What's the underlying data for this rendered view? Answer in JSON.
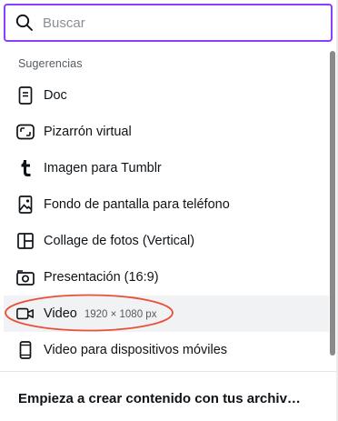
{
  "search": {
    "placeholder": "Buscar",
    "value": "",
    "icon": "search-icon",
    "border_color": "#8b3dff"
  },
  "suggestions": {
    "label": "Sugerencias",
    "items": [
      {
        "label": "Doc",
        "icon": "document-icon"
      },
      {
        "label": "Pizarrón virtual",
        "icon": "whiteboard-icon"
      },
      {
        "label": "Imagen para Tumblr",
        "icon": "tumblr-icon"
      },
      {
        "label": "Fondo de pantalla para teléfono",
        "icon": "image-icon"
      },
      {
        "label": "Collage de fotos (Vertical)",
        "icon": "collage-grid-icon"
      },
      {
        "label": "Presentación (16:9)",
        "icon": "presentation-icon"
      },
      {
        "label": "Video",
        "dimensions": "1920 × 1080 px",
        "icon": "video-camera-icon",
        "highlighted": true
      },
      {
        "label": "Video para dispositivos móviles",
        "icon": "mobile-phone-icon"
      }
    ]
  },
  "footer": {
    "text": "Empieza a crear contenido con tus archiv…"
  },
  "colors": {
    "accent": "#8b3dff",
    "annotation": "#e8503a",
    "hover_bg": "#f1f2f3"
  }
}
